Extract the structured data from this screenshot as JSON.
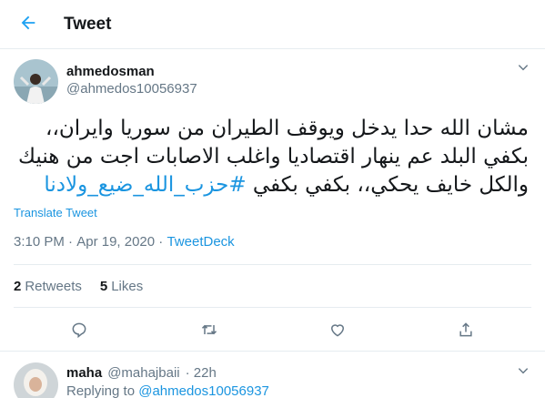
{
  "header": {
    "title": "Tweet",
    "back_icon": "arrow-left-icon"
  },
  "tweet": {
    "author_name": "ahmedosman",
    "author_handle": "@ahmedos10056937",
    "text_plain": "مشان الله حدا يدخل ويوقف الطيران من سوريا وايران،، بكفي البلد عم ينهار اقتصاديا واغلب الاصابات اجت من هنيك والكل خايف يحكي،، بكفي بكفي ",
    "hashtag": "#حزب_الله_ضيع_ولادنا",
    "translate_label": "Translate Tweet",
    "time": "3:10 PM",
    "separator": " · ",
    "date": "Apr 19, 2020",
    "source": "TweetDeck"
  },
  "stats": {
    "retweets_count": "2",
    "retweets_label": "Retweets",
    "likes_count": "5",
    "likes_label": "Likes"
  },
  "actions": [
    "reply-icon",
    "retweet-icon",
    "like-icon",
    "share-icon"
  ],
  "reply": {
    "name": "maha",
    "handle": "@mahajbaii",
    "time": "· 22h",
    "replying_prefix": "Replying to ",
    "replying_to": "@ahmedos10056937"
  },
  "colors": {
    "accent": "#1da1f2",
    "link": "#1b95e0",
    "secondary": "#657786",
    "divider": "#e6ecf0"
  }
}
